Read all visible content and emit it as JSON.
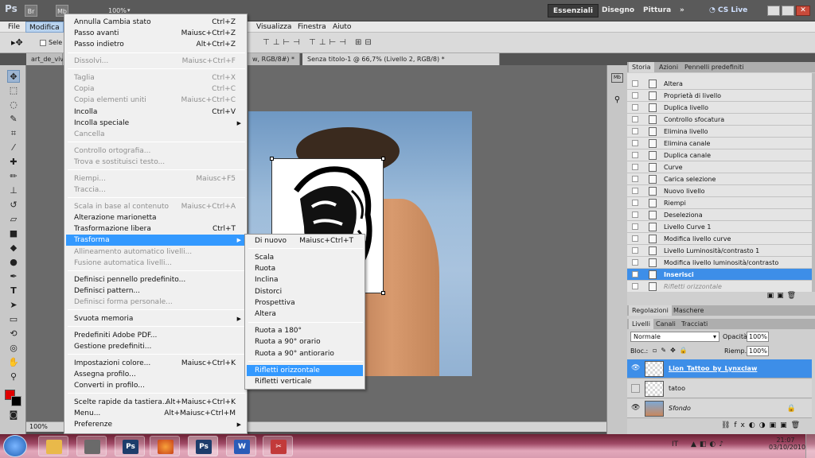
{
  "appbar": {
    "logo": "Ps",
    "br": "Br",
    "mb": "Mb",
    "zoom": "100%",
    "workspaces": [
      "Essenziali",
      "Disegno",
      "Pittura"
    ],
    "more": "»",
    "cslive": "CS Live"
  },
  "menubar": [
    "File",
    "Modifica",
    "Visualizza",
    "Finestra",
    "Aiuto"
  ],
  "options": {
    "select_label": "Sele"
  },
  "tabs": [
    "art_de_viv",
    "w, RGB/8#) *",
    "Senza titolo-1 @ 66,7% (Livello 2, RGB/8) *"
  ],
  "status": {
    "zoom": "100%"
  },
  "menu": [
    {
      "type": "item",
      "label": "Annulla Cambia stato",
      "shortcut": "Ctrl+Z"
    },
    {
      "type": "item",
      "label": "Passo avanti",
      "shortcut": "Maiusc+Ctrl+Z"
    },
    {
      "type": "item",
      "label": "Passo indietro",
      "shortcut": "Alt+Ctrl+Z"
    },
    {
      "type": "sep"
    },
    {
      "type": "item",
      "label": "Dissolvi...",
      "shortcut": "Maiusc+Ctrl+F",
      "disabled": true
    },
    {
      "type": "sep"
    },
    {
      "type": "item",
      "label": "Taglia",
      "shortcut": "Ctrl+X",
      "disabled": true
    },
    {
      "type": "item",
      "label": "Copia",
      "shortcut": "Ctrl+C",
      "disabled": true
    },
    {
      "type": "item",
      "label": "Copia elementi uniti",
      "shortcut": "Maiusc+Ctrl+C",
      "disabled": true
    },
    {
      "type": "item",
      "label": "Incolla",
      "shortcut": "Ctrl+V"
    },
    {
      "type": "item",
      "label": "Incolla speciale",
      "shortcut": "",
      "submenu": true
    },
    {
      "type": "item",
      "label": "Cancella",
      "shortcut": "",
      "disabled": true
    },
    {
      "type": "sep"
    },
    {
      "type": "item",
      "label": "Controllo ortografia...",
      "shortcut": "",
      "disabled": true
    },
    {
      "type": "item",
      "label": "Trova e sostituisci testo...",
      "shortcut": "",
      "disabled": true
    },
    {
      "type": "sep"
    },
    {
      "type": "item",
      "label": "Riempi...",
      "shortcut": "Maiusc+F5",
      "disabled": true
    },
    {
      "type": "item",
      "label": "Traccia...",
      "shortcut": "",
      "disabled": true
    },
    {
      "type": "sep"
    },
    {
      "type": "item",
      "label": "Scala in base al contenuto",
      "shortcut": "Maiusc+Ctrl+A",
      "disabled": true
    },
    {
      "type": "item",
      "label": "Alterazione marionetta",
      "shortcut": ""
    },
    {
      "type": "item",
      "label": "Trasformazione libera",
      "shortcut": "Ctrl+T"
    },
    {
      "type": "item",
      "label": "Trasforma",
      "shortcut": "",
      "submenu": true,
      "highlight": true
    },
    {
      "type": "item",
      "label": "Allineamento automatico livelli...",
      "shortcut": "",
      "disabled": true
    },
    {
      "type": "item",
      "label": "Fusione automatica livelli...",
      "shortcut": "",
      "disabled": true
    },
    {
      "type": "sep"
    },
    {
      "type": "item",
      "label": "Definisci pennello predefinito...",
      "shortcut": ""
    },
    {
      "type": "item",
      "label": "Definisci pattern...",
      "shortcut": ""
    },
    {
      "type": "item",
      "label": "Definisci forma personale...",
      "shortcut": "",
      "disabled": true
    },
    {
      "type": "sep"
    },
    {
      "type": "item",
      "label": "Svuota memoria",
      "shortcut": "",
      "submenu": true
    },
    {
      "type": "sep"
    },
    {
      "type": "item",
      "label": "Predefiniti Adobe PDF...",
      "shortcut": ""
    },
    {
      "type": "item",
      "label": "Gestione predefiniti...",
      "shortcut": ""
    },
    {
      "type": "sep"
    },
    {
      "type": "item",
      "label": "Impostazioni colore...",
      "shortcut": "Maiusc+Ctrl+K"
    },
    {
      "type": "item",
      "label": "Assegna profilo...",
      "shortcut": ""
    },
    {
      "type": "item",
      "label": "Converti in profilo...",
      "shortcut": ""
    },
    {
      "type": "sep"
    },
    {
      "type": "item",
      "label": "Scelte rapide da tastiera...",
      "shortcut": "Alt+Maiusc+Ctrl+K"
    },
    {
      "type": "item",
      "label": "Menu...",
      "shortcut": "Alt+Maiusc+Ctrl+M"
    },
    {
      "type": "item",
      "label": "Preferenze",
      "shortcut": "",
      "submenu": true
    }
  ],
  "submenu": [
    {
      "type": "item",
      "label": "Di nuovo",
      "shortcut": "Maiusc+Ctrl+T"
    },
    {
      "type": "sep"
    },
    {
      "type": "item",
      "label": "Scala"
    },
    {
      "type": "item",
      "label": "Ruota"
    },
    {
      "type": "item",
      "label": "Inclina"
    },
    {
      "type": "item",
      "label": "Distorci"
    },
    {
      "type": "item",
      "label": "Prospettiva"
    },
    {
      "type": "item",
      "label": "Altera"
    },
    {
      "type": "sep"
    },
    {
      "type": "item",
      "label": "Ruota a 180°"
    },
    {
      "type": "item",
      "label": "Ruota a 90° orario"
    },
    {
      "type": "item",
      "label": "Ruota a 90° antiorario"
    },
    {
      "type": "sep"
    },
    {
      "type": "item",
      "label": "Rifletti orizzontale",
      "highlight": true
    },
    {
      "type": "item",
      "label": "Rifletti verticale"
    }
  ],
  "history": {
    "tabs": [
      "Storia",
      "Azioni",
      "Pennelli predefiniti"
    ],
    "items": [
      "Altera",
      "Proprietà di livello",
      "Duplica livello",
      "Controllo sfocatura",
      "Elimina livello",
      "Elimina canale",
      "Duplica canale",
      "Curve",
      "Carica selezione",
      "Nuovo livello",
      "Riempi",
      "Deseleziona",
      "Livello Curve 1",
      "Modifica livello curve",
      "Livello Luminosità/contrasto 1",
      "Modifica livello luminosità/contrasto",
      "Inserisci",
      "Rifletti orizzontale"
    ],
    "selected": "Inserisci",
    "dimmed": "Rifletti orizzontale"
  },
  "adjust": {
    "tabs": [
      "Regolazioni",
      "Maschere"
    ]
  },
  "layers": {
    "tabs": [
      "Livelli",
      "Canali",
      "Tracciati"
    ],
    "blend": "Normale",
    "opacity_label": "Opacità:",
    "opacity": "100%",
    "lock_label": "Bloc.:",
    "fill_label": "Riemp.:",
    "fill": "100%",
    "rows": [
      {
        "name": "Lion_Tattoo_by_Lynxclaw",
        "selected": true
      },
      {
        "name": "tatoo",
        "selected": false
      },
      {
        "name": "Sfondo",
        "selected": false
      }
    ]
  },
  "taskbar": {
    "lang": "IT",
    "time": "21:07",
    "date": "03/10/2010"
  }
}
